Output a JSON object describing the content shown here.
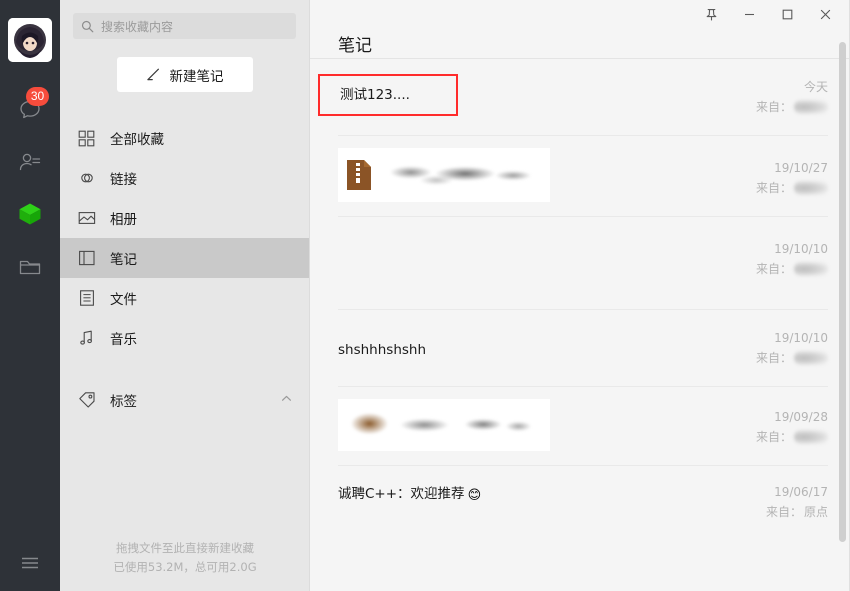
{
  "rail": {
    "avatar_name": "user-avatar",
    "items": [
      {
        "name": "chat-icon",
        "badge": "30"
      },
      {
        "name": "contacts-icon",
        "badge": ""
      },
      {
        "name": "favorites-icon",
        "badge": ""
      },
      {
        "name": "files-icon",
        "badge": ""
      }
    ],
    "menu_label": "menu-icon",
    "accent_badge_color": "#f74c3c",
    "active_icon_color": "#19c419",
    "background": "#2e3238"
  },
  "sidebar": {
    "search": {
      "placeholder": "搜索收藏内容"
    },
    "new_note_button": "新建笔记",
    "items": [
      {
        "label": "全部收藏",
        "icon": "grid-icon",
        "active": false
      },
      {
        "label": "链接",
        "icon": "link-icon",
        "active": false
      },
      {
        "label": "相册",
        "icon": "image-icon",
        "active": false
      },
      {
        "label": "笔记",
        "icon": "note-icon",
        "active": true
      },
      {
        "label": "文件",
        "icon": "file-icon",
        "active": false
      },
      {
        "label": "音乐",
        "icon": "music-icon",
        "active": false
      }
    ],
    "tag_section": {
      "label": "标签",
      "expanded": true
    },
    "footer": {
      "hint": "拖拽文件至此直接新建收藏",
      "storage": "已使用53.2M，总可用2.0G"
    },
    "selected_bg": "#c9c9c9",
    "background": "#e7e7e7"
  },
  "titlebar": {
    "pin": "pin-icon",
    "minimize": "minimize-icon",
    "maximize": "maximize-icon",
    "close": "close-icon"
  },
  "header": {
    "title": "笔记"
  },
  "list": {
    "from_label": "来自：",
    "highlight_color": "#ff2b2b",
    "rows": [
      {
        "title": "测试123....",
        "date": "今天",
        "from": "",
        "from_redacted": true,
        "highlighted": true,
        "type": "text"
      },
      {
        "title": "",
        "date": "19/10/27",
        "from": "",
        "from_redacted": true,
        "highlighted": false,
        "type": "file-card",
        "file_icon": "zip-file-icon"
      },
      {
        "title": "",
        "date": "19/10/10",
        "from": "",
        "from_redacted": true,
        "highlighted": false,
        "type": "empty"
      },
      {
        "title": "shshhhshshh",
        "date": "19/10/10",
        "from": "",
        "from_redacted": true,
        "highlighted": false,
        "type": "text"
      },
      {
        "title": "",
        "date": "19/09/28",
        "from": "",
        "from_redacted": true,
        "highlighted": false,
        "type": "image-card"
      },
      {
        "title": "诚聘C++：欢迎推荐",
        "emoji": "😊",
        "date": "19/06/17",
        "from": "原点",
        "from_redacted": false,
        "highlighted": false,
        "type": "text"
      }
    ]
  }
}
